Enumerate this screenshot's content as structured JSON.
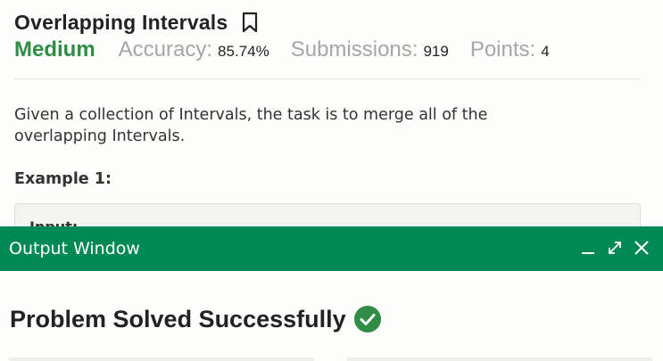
{
  "problem": {
    "title": "Overlapping Intervals",
    "difficulty": "Medium",
    "accuracy_label": "Accuracy:",
    "accuracy_value": "85.74%",
    "submissions_label": "Submissions:",
    "submissions_value": "919",
    "points_label": "Points:",
    "points_value": "4",
    "description": "Given a collection of Intervals, the task is to merge all of the overlapping Intervals.",
    "example_heading": "Example 1:",
    "example_partial": "Input:"
  },
  "output_window": {
    "title": "Output Window",
    "result": "Problem Solved Successfully"
  },
  "colors": {
    "accent_green": "#2f8d46",
    "output_bar": "#008955"
  },
  "icons": {
    "bookmark": "bookmark-icon",
    "minimize": "minimize-icon",
    "expand": "expand-icon",
    "close": "close-icon",
    "success": "check-circle-icon"
  }
}
